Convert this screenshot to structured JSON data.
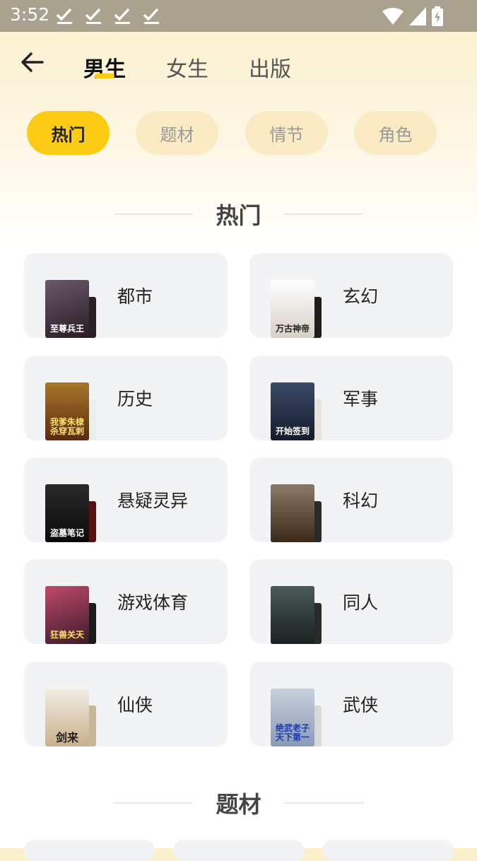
{
  "status_bar": {
    "time": "3:52"
  },
  "top_tabs": [
    {
      "label": "男生",
      "active": true
    },
    {
      "label": "女生",
      "active": false
    },
    {
      "label": "出版",
      "active": false
    }
  ],
  "filter_chips": [
    {
      "label": "热门",
      "active": true
    },
    {
      "label": "题材",
      "active": false
    },
    {
      "label": "情节",
      "active": false
    },
    {
      "label": "角色",
      "active": false
    }
  ],
  "sections": [
    {
      "title": "热门"
    },
    {
      "title": "题材"
    }
  ],
  "categories": [
    {
      "label": "都市",
      "cover_text": "至尊兵王",
      "cover_color": "#3A2A3A"
    },
    {
      "label": "玄幻",
      "cover_text": "万古神帝",
      "cover_color": "#E8E2DC"
    },
    {
      "label": "历史",
      "cover_text": "我爹朱棣 杀穿瓦剌",
      "cover_color": "#6B3A1A"
    },
    {
      "label": "军事",
      "cover_text": "开始签到",
      "cover_color": "#233047"
    },
    {
      "label": "悬疑灵异",
      "cover_text": "盗墓笔记",
      "cover_color": "#1A1A1A"
    },
    {
      "label": "科幻",
      "cover_text": "",
      "cover_color": "#4A3A2A"
    },
    {
      "label": "游戏体育",
      "cover_text": "狂兽关天",
      "cover_color": "#5A2A3A"
    },
    {
      "label": "同人",
      "cover_text": "",
      "cover_color": "#2A3A3A"
    },
    {
      "label": "仙侠",
      "cover_text": "剑来",
      "cover_color": "#E2D8C4"
    },
    {
      "label": "武侠",
      "cover_text": "绝武老子 天下第一",
      "cover_color": "#B8C4D8"
    }
  ]
}
